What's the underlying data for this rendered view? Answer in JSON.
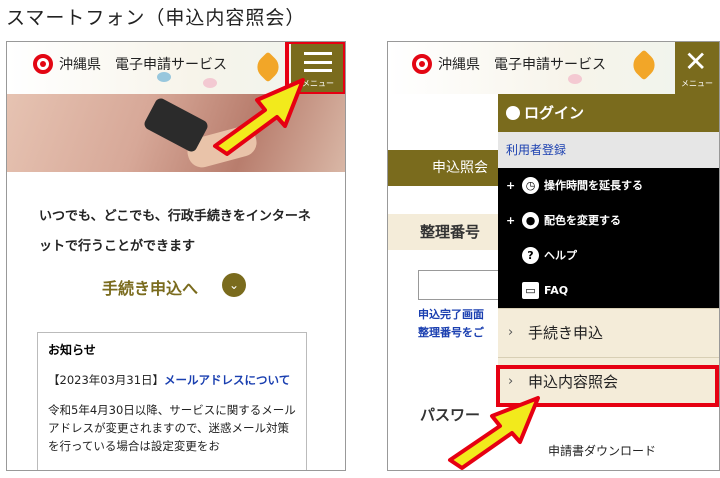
{
  "caption": "スマートフォン（申込内容照会）",
  "header": {
    "site_name": "沖縄県　電子申請サービス",
    "menu_label": "メニュー",
    "close_glyph": "✕"
  },
  "left": {
    "lead_text": "いつでも、どこでも、行政手続きをインターネットで行うことができます",
    "procedure_link": "手続き申込へ",
    "procedure_icon": "chevron-down-icon",
    "notice": {
      "title": "お知らせ",
      "date": "【2023年03月31日】",
      "link": "メールアドレスについて",
      "body": "令和5年4月30日以降、サービスに関するメールアドレスが変更されますので、迷惑メール対策を行っている場合は設定変更をお"
    }
  },
  "right": {
    "bg_band": "申込照会",
    "bg_title1": "整理番号",
    "bg_note": [
      "申込完了画面",
      "整理番号をご"
    ],
    "bg_title2": "パスワー",
    "menu": {
      "login": "ログイン",
      "register": "利用者登録",
      "extend": "操作時間を延長する",
      "color": "配色を変更する",
      "help": "ヘルプ",
      "faq": "FAQ",
      "apply": "手続き申込",
      "inquiry": "申込内容照会",
      "download": "申請書ダウンロード"
    }
  },
  "colors": {
    "accent": "#7a6b1d",
    "highlight": "#e60012",
    "arrow_fill": "#f2ea1c",
    "link": "#1a3fb0"
  }
}
